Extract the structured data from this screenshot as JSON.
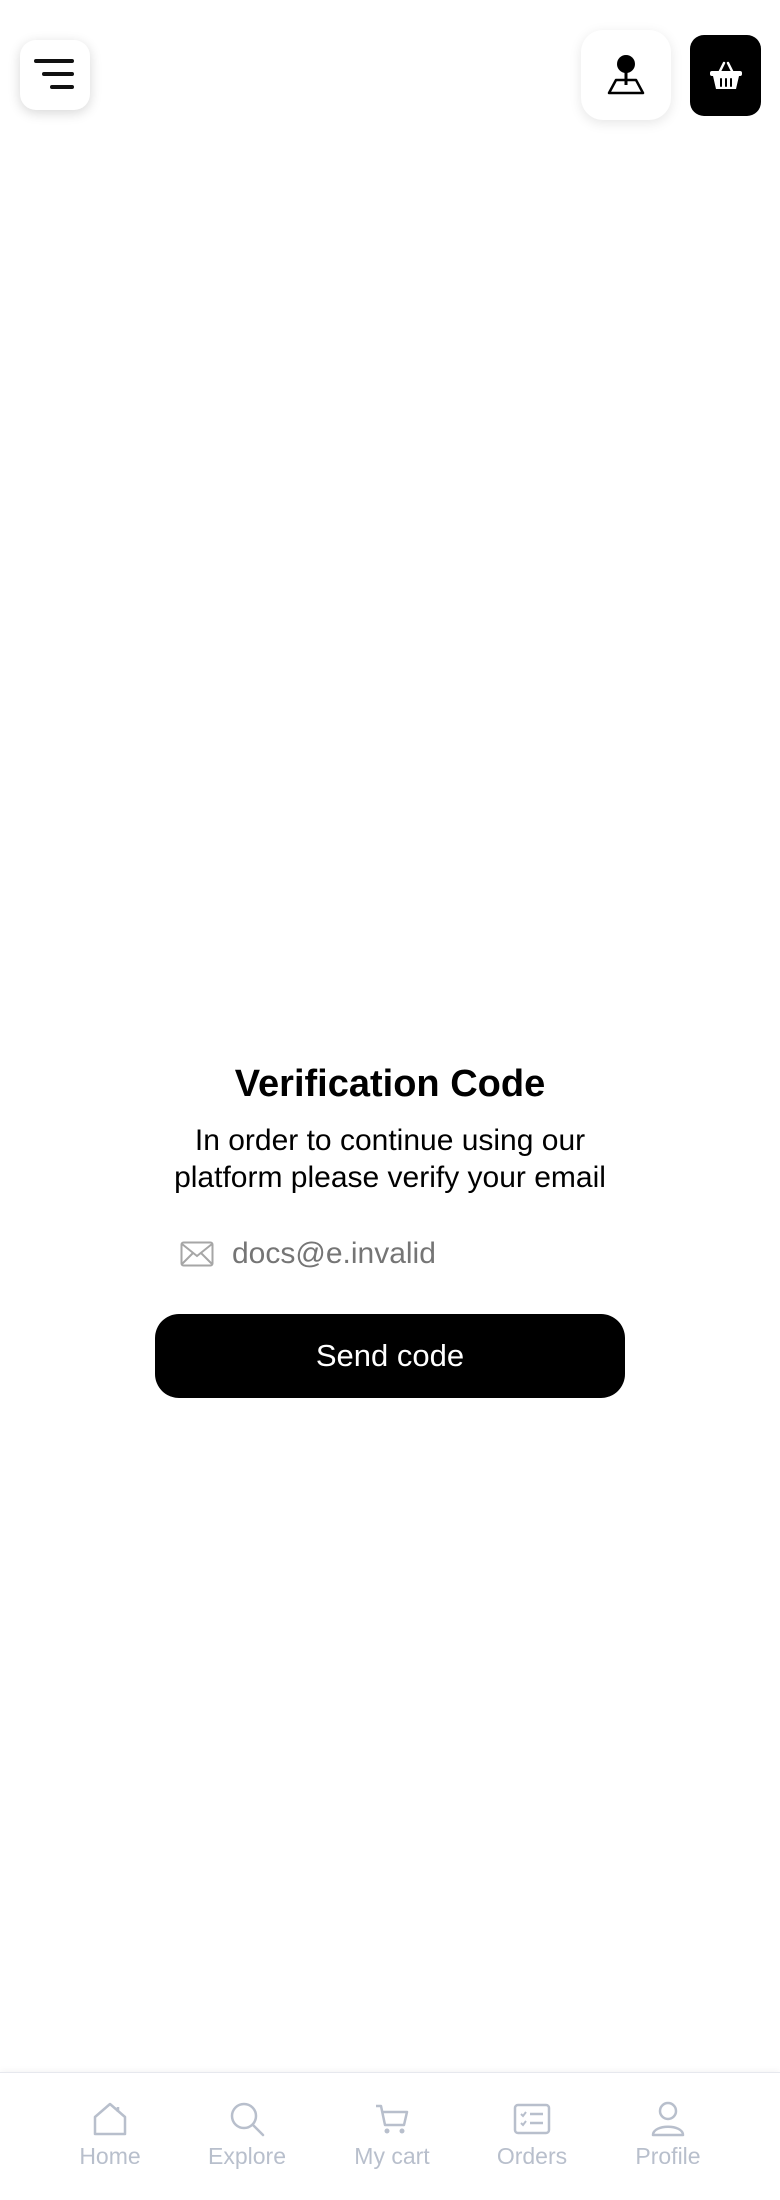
{
  "header": {
    "menu_icon": "menu-lines-icon",
    "location_icon": "map-pin-icon",
    "cart_icon": "basket-icon"
  },
  "verification": {
    "title": "Verification Code",
    "description": "In order to continue using our platform please verify your email",
    "email_icon": "mail-icon",
    "email_placeholder": "docs@e.invalid",
    "send_label": "Send code"
  },
  "nav": {
    "items": [
      {
        "label": "Home",
        "icon": "home-icon"
      },
      {
        "label": "Explore",
        "icon": "search-icon"
      },
      {
        "label": "My cart",
        "icon": "cart-icon"
      },
      {
        "label": "Orders",
        "icon": "orders-icon"
      },
      {
        "label": "Profile",
        "icon": "user-icon"
      }
    ]
  },
  "colors": {
    "primary": "#000000",
    "nav_inactive": "#b8bfcc",
    "placeholder": "#9e9e9e"
  }
}
